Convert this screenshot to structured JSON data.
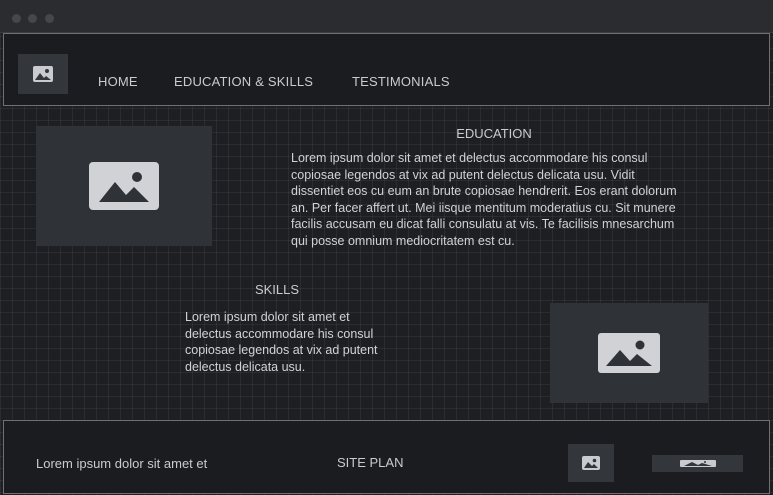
{
  "nav": {
    "items": [
      {
        "label": "HOME"
      },
      {
        "label": "EDUCATION & SKILLS"
      },
      {
        "label": "TESTIMONIALS"
      }
    ]
  },
  "education": {
    "title": "EDUCATION",
    "text": "Lorem ipsum dolor sit amet et delectus accommodare his consul copiosae legendos at vix ad putent delectus delicata usu. Vidit dissentiet eos cu eum an brute copiosae hendrerit. Eos erant dolorum an. Per facer affert ut. Mei iisque mentitum moderatius cu. Sit munere facilis accusam eu dicat falli consulatu at vis. Te facilisis mnesarchum qui posse omnium mediocritatem est cu."
  },
  "skills": {
    "title": "SKILLS",
    "text": "Lorem ipsum dolor sit amet et delectus accommodare his consul copiosae legendos at vix ad putent delectus delicata usu."
  },
  "footer": {
    "text": "Lorem ipsum dolor sit amet et",
    "link": "SITE PLAN"
  },
  "icons": {
    "logo": "image-placeholder-icon",
    "education_image": "image-placeholder-icon",
    "skills_image": "image-placeholder-icon",
    "footer_image": "image-placeholder-icon",
    "footer_banner": "image-placeholder-icon"
  },
  "colors": {
    "background": "#1e1f22",
    "panel": "#2f3236",
    "text": "#c9cbcf",
    "border": "#6e7074"
  }
}
